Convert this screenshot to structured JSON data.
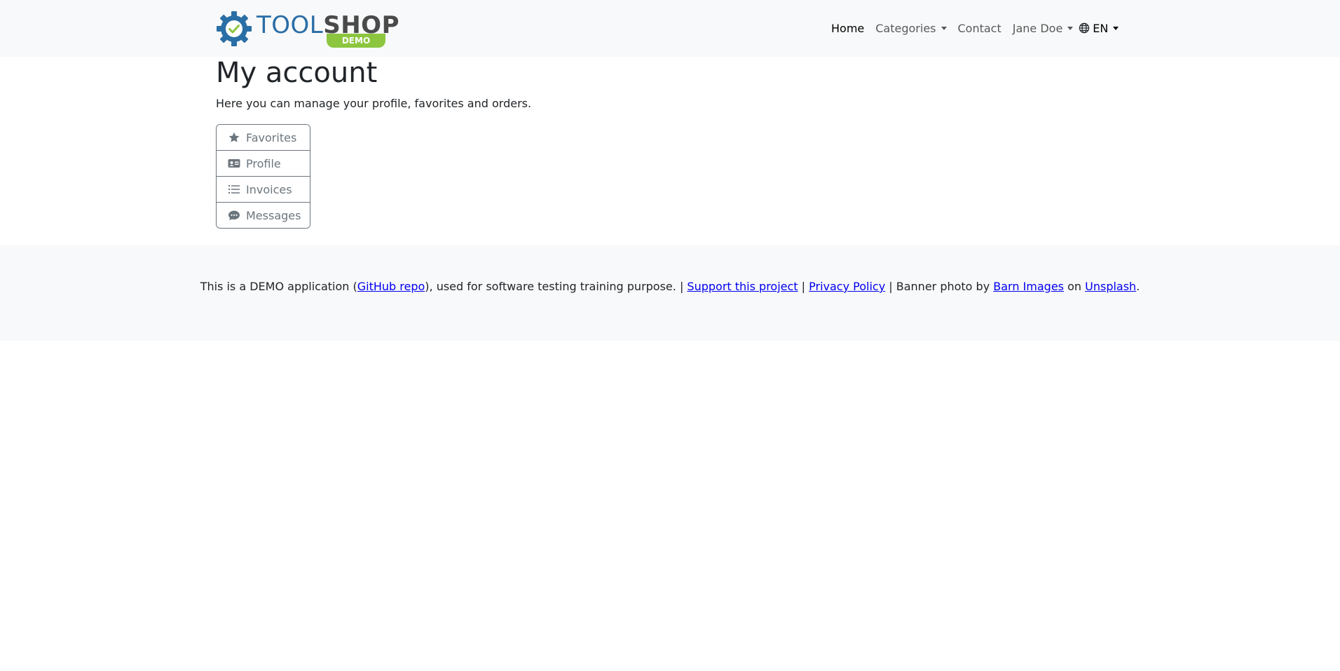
{
  "brand": {
    "word_tool": "TOOL",
    "word_shop": "SHOP",
    "badge": "DEMO",
    "colors": {
      "tool": "#2a6ea6",
      "shop": "#4a4a4a",
      "badge": "#8cc63f",
      "check": "#8cc63f"
    }
  },
  "nav": {
    "home": "Home",
    "categories": "Categories",
    "contact": "Contact",
    "user": "Jane Doe",
    "language": "EN",
    "language_icon": "globe-icon"
  },
  "page": {
    "title": "My account",
    "subtitle": "Here you can manage your profile, favorites and orders."
  },
  "account_menu": [
    {
      "label": "Favorites",
      "icon": "star-icon"
    },
    {
      "label": "Profile",
      "icon": "id-card-icon"
    },
    {
      "label": "Invoices",
      "icon": "list-icon"
    },
    {
      "label": "Messages",
      "icon": "chat-icon"
    }
  ],
  "footer": {
    "t1": "This is a DEMO application (",
    "github_link": "GitHub repo",
    "t2": "), used for software testing training purpose. | ",
    "support_link": "Support this project",
    "t3": " | ",
    "privacy_link": "Privacy Policy",
    "t4": " | Banner photo by ",
    "barn_link": "Barn Images",
    "t5": " on ",
    "unsplash_link": "Unsplash",
    "t6": "."
  }
}
